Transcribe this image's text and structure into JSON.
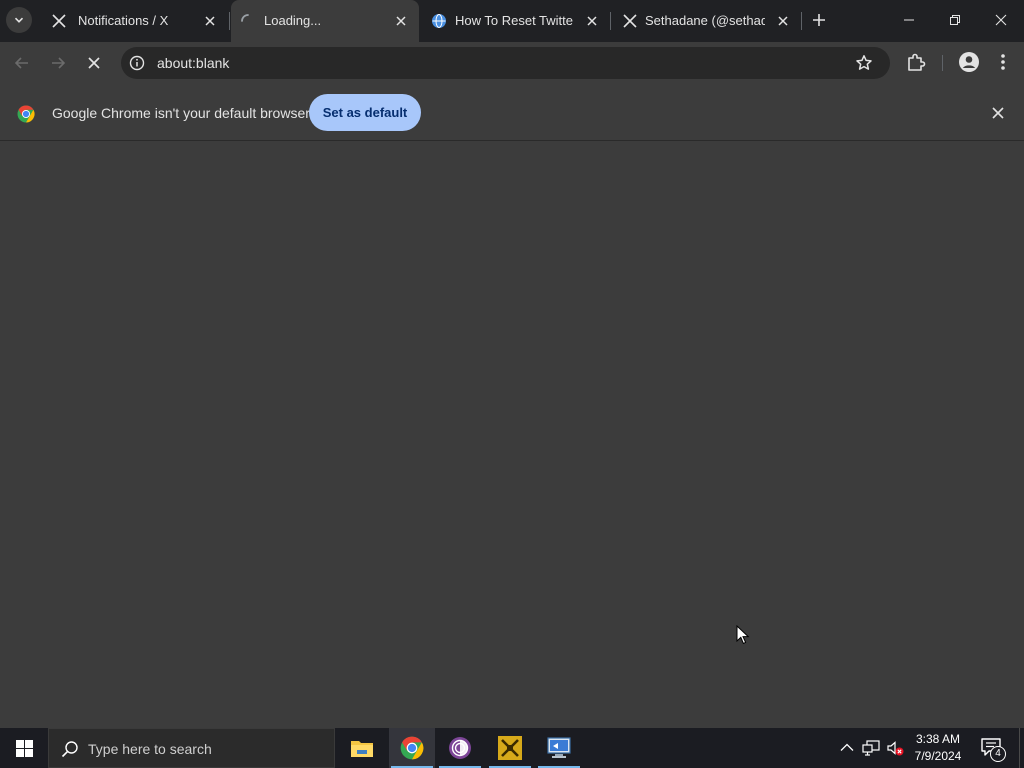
{
  "browser": {
    "tabs": [
      {
        "title": "Notifications / X",
        "favicon": "x-logo-icon",
        "active": false
      },
      {
        "title": "Loading...",
        "favicon": "loading-spinner-icon",
        "active": true
      },
      {
        "title": "How To Reset Twitter A",
        "favicon": "globe-icon",
        "active": false
      },
      {
        "title": "Sethadane (@sethadar",
        "favicon": "x-logo-icon",
        "active": false
      }
    ],
    "address": "about:blank",
    "infobar": {
      "message": "Google Chrome isn't your default browser",
      "button_label": "Set as default"
    }
  },
  "taskbar": {
    "search_placeholder": "Type here to search",
    "apps": [
      "file-explorer-icon",
      "chrome-icon",
      "tor-browser-icon",
      "app-icon",
      "remote-desktop-icon"
    ],
    "time": "3:38 AM",
    "date": "7/9/2024",
    "notification_count": "4"
  },
  "colors": {
    "tabstrip": "#202124",
    "surface": "#3c3c3c",
    "accent_button": "#a8c7fa",
    "taskbar": "#1b1c22"
  }
}
